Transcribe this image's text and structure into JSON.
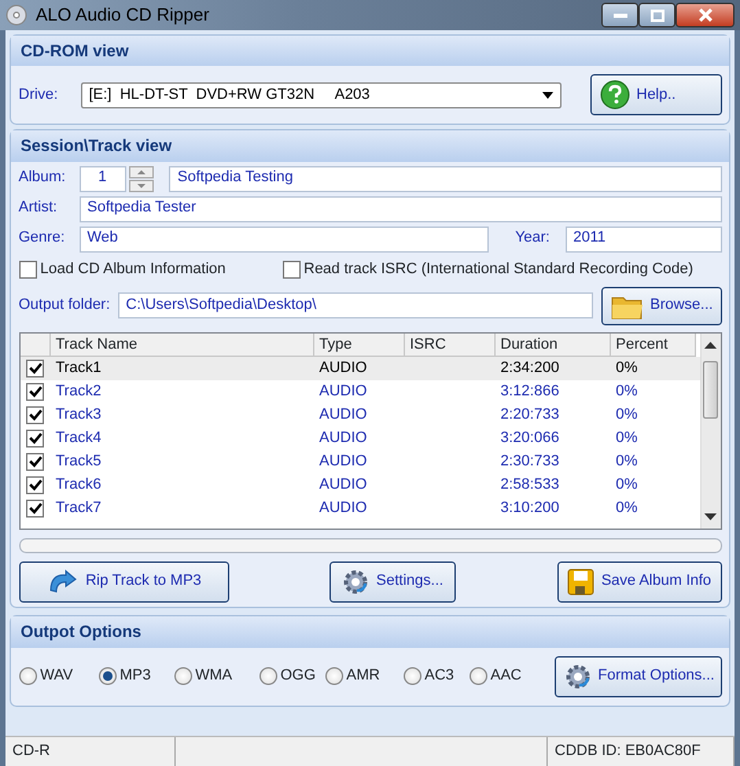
{
  "window": {
    "title": "ALO Audio CD Ripper"
  },
  "cdrom_view": {
    "title": "CD-ROM view",
    "drive_label": "Drive:",
    "drive_value": "[E:]  HL-DT-ST  DVD+RW GT32N     A203",
    "help_button": "Help.."
  },
  "session_view": {
    "title": "Session\\Track view",
    "album_label": "Album:",
    "album_number": "1",
    "album_title": "Softpedia Testing",
    "artist_label": "Artist:",
    "artist": "Softpedia Tester",
    "genre_label": "Genre:",
    "genre": "Web",
    "year_label": "Year:",
    "year": "2011",
    "options": [
      {
        "label": "Load CD Album Information",
        "checked": false
      },
      {
        "label": "Read track ISRC (International Standard Recording Code)",
        "checked": false
      }
    ],
    "output_folder_label": "Output folder:",
    "output_folder": "C:\\Users\\Softpedia\\Desktop\\",
    "browse_button": "Browse...",
    "table": {
      "columns": [
        "Track Name",
        "Type",
        "ISRC",
        "Duration",
        "Percent"
      ],
      "rows": [
        {
          "checked": true,
          "selected": true,
          "cells": [
            "Track1",
            "AUDIO",
            null,
            "2:34:200",
            "0%"
          ]
        },
        {
          "checked": true,
          "selected": false,
          "cells": [
            "Track2",
            "AUDIO",
            null,
            "3:12:866",
            "0%"
          ]
        },
        {
          "checked": true,
          "selected": false,
          "cells": [
            "Track3",
            "AUDIO",
            null,
            "2:20:733",
            "0%"
          ]
        },
        {
          "checked": true,
          "selected": false,
          "cells": [
            "Track4",
            "AUDIO",
            null,
            "3:20:066",
            "0%"
          ]
        },
        {
          "checked": true,
          "selected": false,
          "cells": [
            "Track5",
            "AUDIO",
            null,
            "2:30:733",
            "0%"
          ]
        },
        {
          "checked": true,
          "selected": false,
          "cells": [
            "Track6",
            "AUDIO",
            null,
            "2:58:533",
            "0%"
          ]
        },
        {
          "checked": true,
          "selected": false,
          "cells": [
            "Track7",
            "AUDIO",
            null,
            "3:10:200",
            "0%"
          ]
        }
      ]
    },
    "progress": {
      "level": 0
    },
    "buttons": [
      {
        "kind": "rip",
        "label": "Rip Track to MP3"
      },
      {
        "kind": "settings",
        "label": "Settings..."
      },
      {
        "kind": "save",
        "label": "Save Album Info"
      }
    ]
  },
  "output_options": {
    "title": "Outpot Options",
    "formats": [
      {
        "label": "WAV",
        "selected": false
      },
      {
        "label": "MP3",
        "selected": true
      },
      {
        "label": "WMA",
        "selected": false
      },
      {
        "label": "OGG",
        "selected": false
      },
      {
        "label": "AMR",
        "selected": false
      },
      {
        "label": "AC3",
        "selected": false
      },
      {
        "label": "AAC",
        "selected": false
      }
    ],
    "format_button": "Format Options..."
  },
  "status_bar": {
    "left": "CD-R",
    "right": "CDDB ID: EB0AC80F"
  }
}
